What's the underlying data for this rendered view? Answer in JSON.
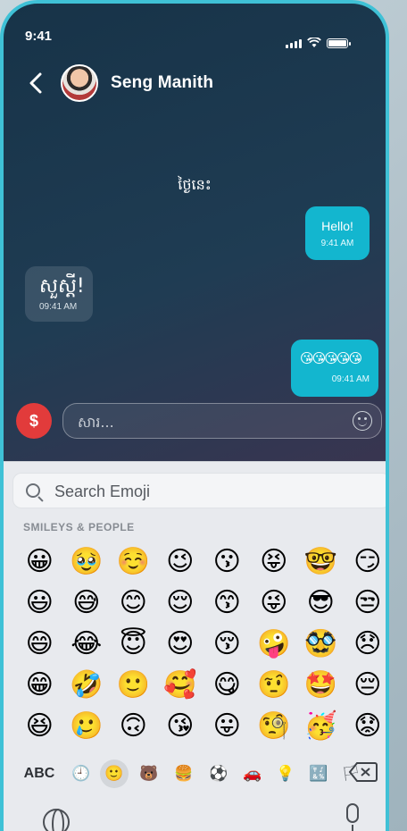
{
  "status_bar": {
    "time": "9:41"
  },
  "header": {
    "contact_name": "Seng Manith"
  },
  "chat": {
    "date_label": "ថ្ងៃនេះ",
    "messages": [
      {
        "direction": "outgoing",
        "text": "Hello!",
        "time": "9:41 AM"
      },
      {
        "direction": "incoming",
        "text": "សួស្តី!",
        "time": "09:41 AM"
      },
      {
        "direction": "outgoing",
        "text": "😘😘😘😘😘",
        "time": "09:41 AM"
      }
    ]
  },
  "composer": {
    "placeholder": "សារ..."
  },
  "keyboard": {
    "search_placeholder": "Search Emoji",
    "section_title": "SMILEYS & PEOPLE",
    "emojis": [
      "😀",
      "🥹",
      "☺️",
      "😉",
      "😗",
      "😝",
      "🤓",
      "😏",
      "😃",
      "😅",
      "😊",
      "😌",
      "😙",
      "😜",
      "😎",
      "😒",
      "😄",
      "😂",
      "😇",
      "😍",
      "😚",
      "🤪",
      "🥸",
      "😞",
      "😁",
      "🤣",
      "🙂",
      "🥰",
      "😋",
      "🤨",
      "🤩",
      "😔",
      "😆",
      "🥲",
      "🙃",
      "😘",
      "😛",
      "🧐",
      "🥳",
      "😟"
    ],
    "abc_label": "ABC",
    "categories": [
      "🕘",
      "🙂",
      "🐻",
      "🍔",
      "⚽",
      "🚗",
      "💡",
      "🔣",
      "🏳"
    ]
  },
  "colors": {
    "accent": "#13b6cf",
    "coin_button": "#e23b3b"
  }
}
